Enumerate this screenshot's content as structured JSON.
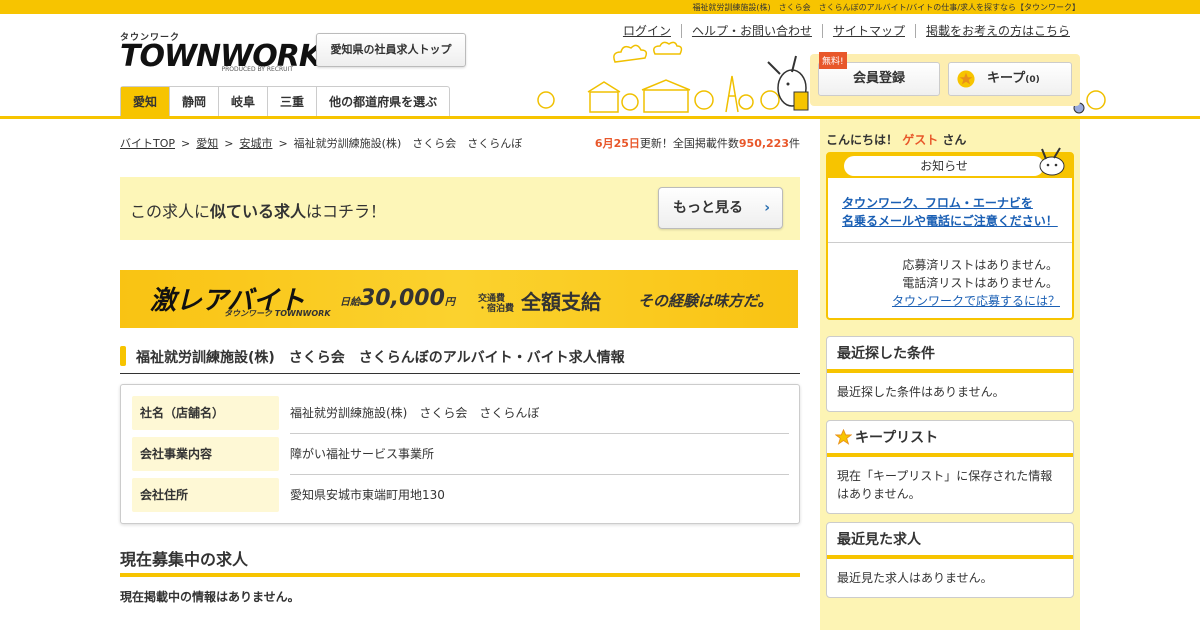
{
  "header": {
    "top_caption": "福祉就労訓練施設(株)　さくら会　さくらんぼのアルバイト/バイトの仕事/求人を探すなら【タウンワーク】",
    "logo_kana": "タウンワーク",
    "logo_word": "TOWNWORK",
    "logo_produced": "PRODUCED BY RECRUIT",
    "region_button": "愛知県の社員求人トップ",
    "links": [
      "ログイン",
      "ヘルプ・お問い合わせ",
      "サイトマップ",
      "掲載をお考えの方はこちら"
    ],
    "free_badge": "無料!",
    "register_button": "会員登録",
    "keep_button": "キープ",
    "keep_count": "(0)"
  },
  "nav": {
    "tabs": [
      "愛知",
      "静岡",
      "岐阜",
      "三重",
      "他の都道府県を選ぶ"
    ]
  },
  "breadcrumb": {
    "items": [
      "バイトTOP",
      "愛知",
      "安城市"
    ],
    "current": "福祉就労訓練施設(株)　さくら会　さくらんぼ",
    "sep": ">"
  },
  "status": {
    "date": "6月25日",
    "updated_text": "更新！全国掲載件数",
    "count": "950,223",
    "unit": "件"
  },
  "similar": {
    "pre": "この求人に",
    "bold": "似ている求人",
    "post": "はコチラ！",
    "more_button": "もっと見る",
    "chevron": "›"
  },
  "banner": {
    "main": "激レアバイト",
    "brand": "タウンワーク TOWNWORK",
    "daily_label": "日給",
    "daily_amount": "30,000",
    "daily_unit": "円",
    "transport_label_1": "交通費",
    "transport_label_2": "・宿泊費",
    "transport_text": "全額支給",
    "tagline": "その経験は味方だ。"
  },
  "company": {
    "section_title": "福祉就労訓練施設(株)　さくら会　さくらんぼのアルバイト・バイト求人情報",
    "rows": [
      {
        "key": "社名（店舗名）",
        "value": "福祉就労訓練施設(株)　さくら会　さくらんぼ"
      },
      {
        "key": "会社事業内容",
        "value": "障がい福祉サービス事業所"
      },
      {
        "key": "会社住所",
        "value": "愛知県安城市東端町用地130"
      }
    ]
  },
  "recruiting": {
    "heading": "現在募集中の求人",
    "none": "現在掲載中の情報はありません。"
  },
  "sidebar": {
    "hello_pre": "こんにちは！",
    "hello_guest": "ゲスト",
    "hello_post": "さん",
    "notice_title": "お知らせ",
    "notice_link_1": "タウンワーク、フロム・エーナビを",
    "notice_link_2": "名乗るメールや電話にご注意ください！",
    "applied_none": "応募済リストはありません。",
    "called_none": "電話済リストはありません。",
    "how_to_apply": "タウンワークで応募するには？",
    "recent_search_title": "最近探した条件",
    "recent_search_none": "最近探した条件はありません。",
    "keep_list_title": "キープリスト",
    "keep_list_none": "現在「キープリスト」に保存された情報はありません。",
    "recent_viewed_title": "最近見た求人",
    "recent_viewed_none": "最近見た求人はありません。"
  },
  "colors": {
    "accent": "#f7c400",
    "highlight": "#e8572a",
    "link": "#1a5fb4"
  }
}
